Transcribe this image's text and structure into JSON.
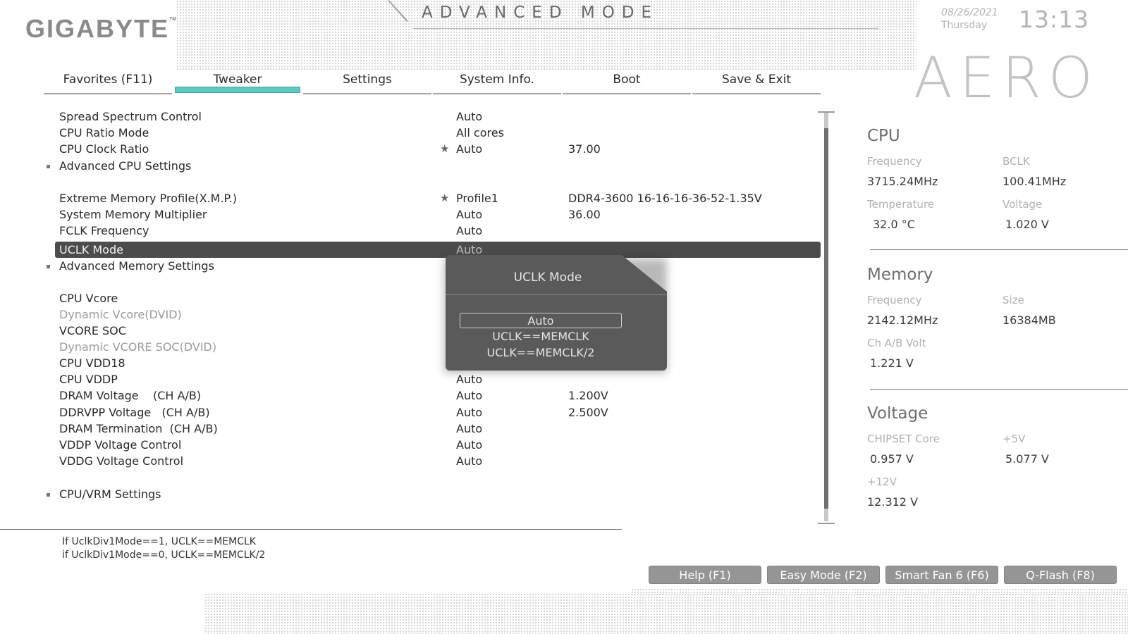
{
  "header": {
    "brand": "GIGABYTE",
    "brand_tm": "TM",
    "mode_title": "ADVANCED MODE",
    "date": "08/26/2021",
    "weekday": "Thursday",
    "time": "13:13",
    "model_logo": "AERO"
  },
  "tabs": [
    {
      "label": "Favorites (F11)",
      "active": false
    },
    {
      "label": "Tweaker",
      "active": true
    },
    {
      "label": "Settings",
      "active": false
    },
    {
      "label": "System Info.",
      "active": false
    },
    {
      "label": "Boot",
      "active": false
    },
    {
      "label": "Save & Exit",
      "active": false
    }
  ],
  "settings": [
    {
      "label": "Spread Spectrum Control",
      "value": "Auto",
      "value2": ""
    },
    {
      "label": "CPU Ratio Mode",
      "value": "All cores",
      "value2": ""
    },
    {
      "label": "CPU Clock Ratio",
      "value": "Auto",
      "value2": "37.00",
      "star": "★"
    },
    {
      "label": "Advanced CPU Settings",
      "submenu": true
    },
    {
      "label": "Extreme Memory Profile(X.M.P.)",
      "value": "Profile1",
      "value2": "DDR4-3600 16-16-16-36-52-1.35V",
      "star": "★"
    },
    {
      "label": "System Memory Multiplier",
      "value": "Auto",
      "value2": "36.00"
    },
    {
      "label": "FCLK Frequency",
      "value": "Auto"
    },
    {
      "label": "UCLK Mode",
      "value": "Auto",
      "selected": true
    },
    {
      "label": "Advanced Memory Settings",
      "submenu": true
    },
    {
      "label": "CPU Vcore",
      "value": ""
    },
    {
      "label": "Dynamic Vcore(DVID)",
      "value": "",
      "disabled": true
    },
    {
      "label": "VCORE SOC",
      "value": ""
    },
    {
      "label": "Dynamic VCORE SOC(DVID)",
      "value": "",
      "disabled": true
    },
    {
      "label": "CPU VDD18",
      "value": ""
    },
    {
      "label": "CPU VDDP",
      "value": "Auto"
    },
    {
      "label": "DRAM Voltage    (CH A/B)",
      "value": "Auto",
      "value2": "1.200V"
    },
    {
      "label": "DDRVPP Voltage   (CH A/B)",
      "value": "Auto",
      "value2": "2.500V"
    },
    {
      "label": "DRAM Termination  (CH A/B)",
      "value": "Auto"
    },
    {
      "label": "VDDP Voltage Control",
      "value": "Auto"
    },
    {
      "label": "VDDG Voltage Control",
      "value": "Auto"
    },
    {
      "label": "CPU/VRM Settings",
      "submenu": true
    }
  ],
  "popup": {
    "title": "UCLK Mode",
    "options": [
      "Auto",
      "UCLK==MEMCLK",
      "UCLK==MEMCLK/2"
    ],
    "selected_index": 0
  },
  "help": {
    "line1": "If UclkDiv1Mode==1, UCLK==MEMCLK",
    "line2": "if UclkDiv1Mode==0, UCLK==MEMCLK/2"
  },
  "info": {
    "cpu": {
      "title": "CPU",
      "frequency_label": "Frequency",
      "frequency": "3715.24MHz",
      "bclk_label": "BCLK",
      "bclk": "100.41MHz",
      "temperature_label": "Temperature",
      "temperature": "32.0 °C",
      "voltage_label": "Voltage",
      "voltage": "1.020 V"
    },
    "memory": {
      "title": "Memory",
      "frequency_label": "Frequency",
      "frequency": "2142.12MHz",
      "size_label": "Size",
      "size": "16384MB",
      "volt_label": "Ch A/B Volt",
      "volt": "1.221 V"
    },
    "voltage": {
      "title": "Voltage",
      "chipset_label": "CHIPSET Core",
      "chipset": "0.957 V",
      "p5_label": "+5V",
      "p5": "5.077 V",
      "p12_label": "+12V",
      "p12": "12.312 V"
    }
  },
  "footer_buttons": [
    "Help (F1)",
    "Easy Mode (F2)",
    "Smart Fan 6 (F6)",
    "Q-Flash (F8)"
  ],
  "colors": {
    "accent": "#5fc9c0",
    "selected_row": "#4c4c4c",
    "popup_bg": "#5a5a5a",
    "button_bg": "#959595"
  }
}
